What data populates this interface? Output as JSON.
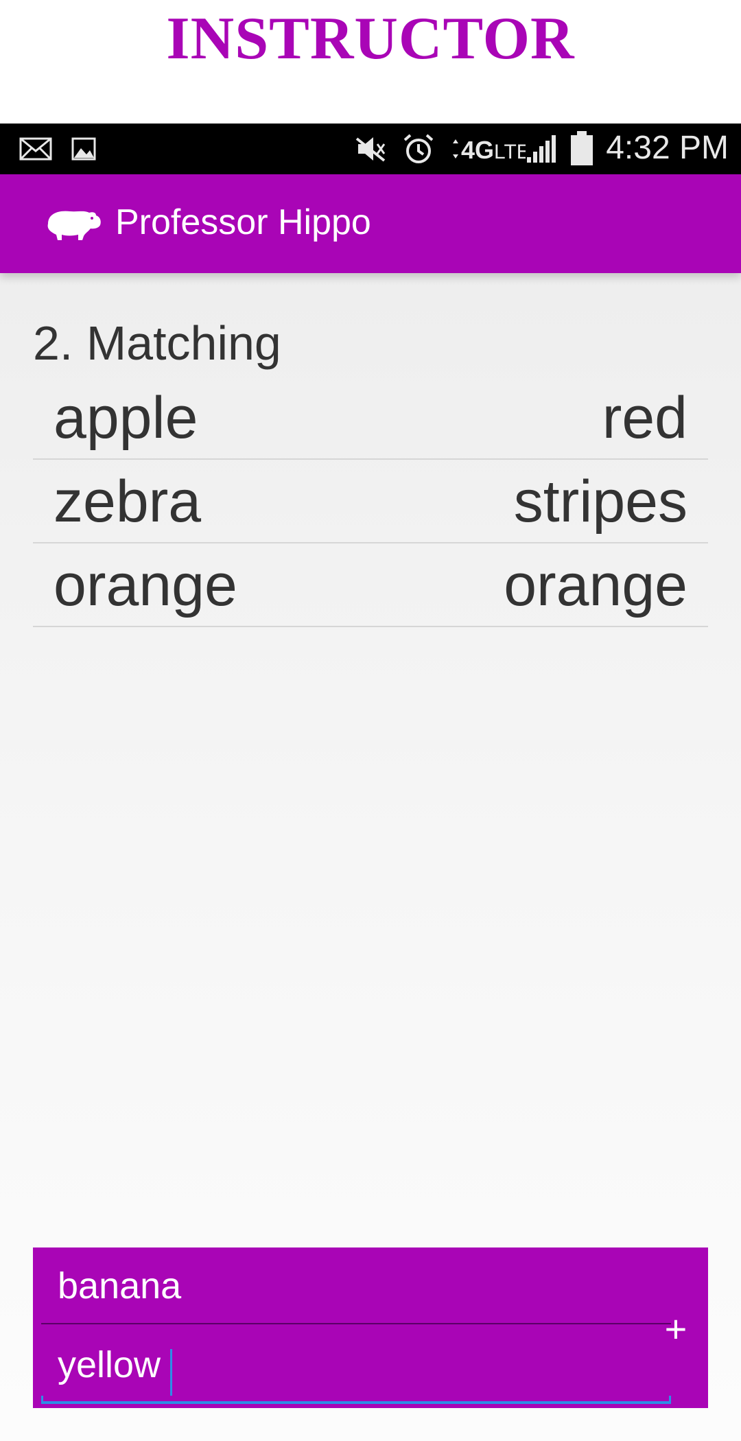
{
  "banner": {
    "title": "INSTRUCTOR"
  },
  "status_bar": {
    "time": "4:32 PM",
    "icons": [
      "mail-icon",
      "image-icon",
      "mute-icon",
      "alarm-icon",
      "4g-lte-icon",
      "signal-icon",
      "battery-icon"
    ]
  },
  "app": {
    "title": "Professor Hippo",
    "logo_icon": "hippo-icon"
  },
  "question": {
    "title": "2. Matching",
    "pairs": [
      {
        "left": "apple",
        "right": "red"
      },
      {
        "left": "zebra",
        "right": "stripes"
      },
      {
        "left": "orange",
        "right": "orange"
      }
    ]
  },
  "add_form": {
    "field1_value": "banana",
    "field2_value": "yellow",
    "add_label": "+"
  },
  "colors": {
    "accent": "#a905b6",
    "text": "#333333",
    "focus": "#2d8ee6"
  }
}
